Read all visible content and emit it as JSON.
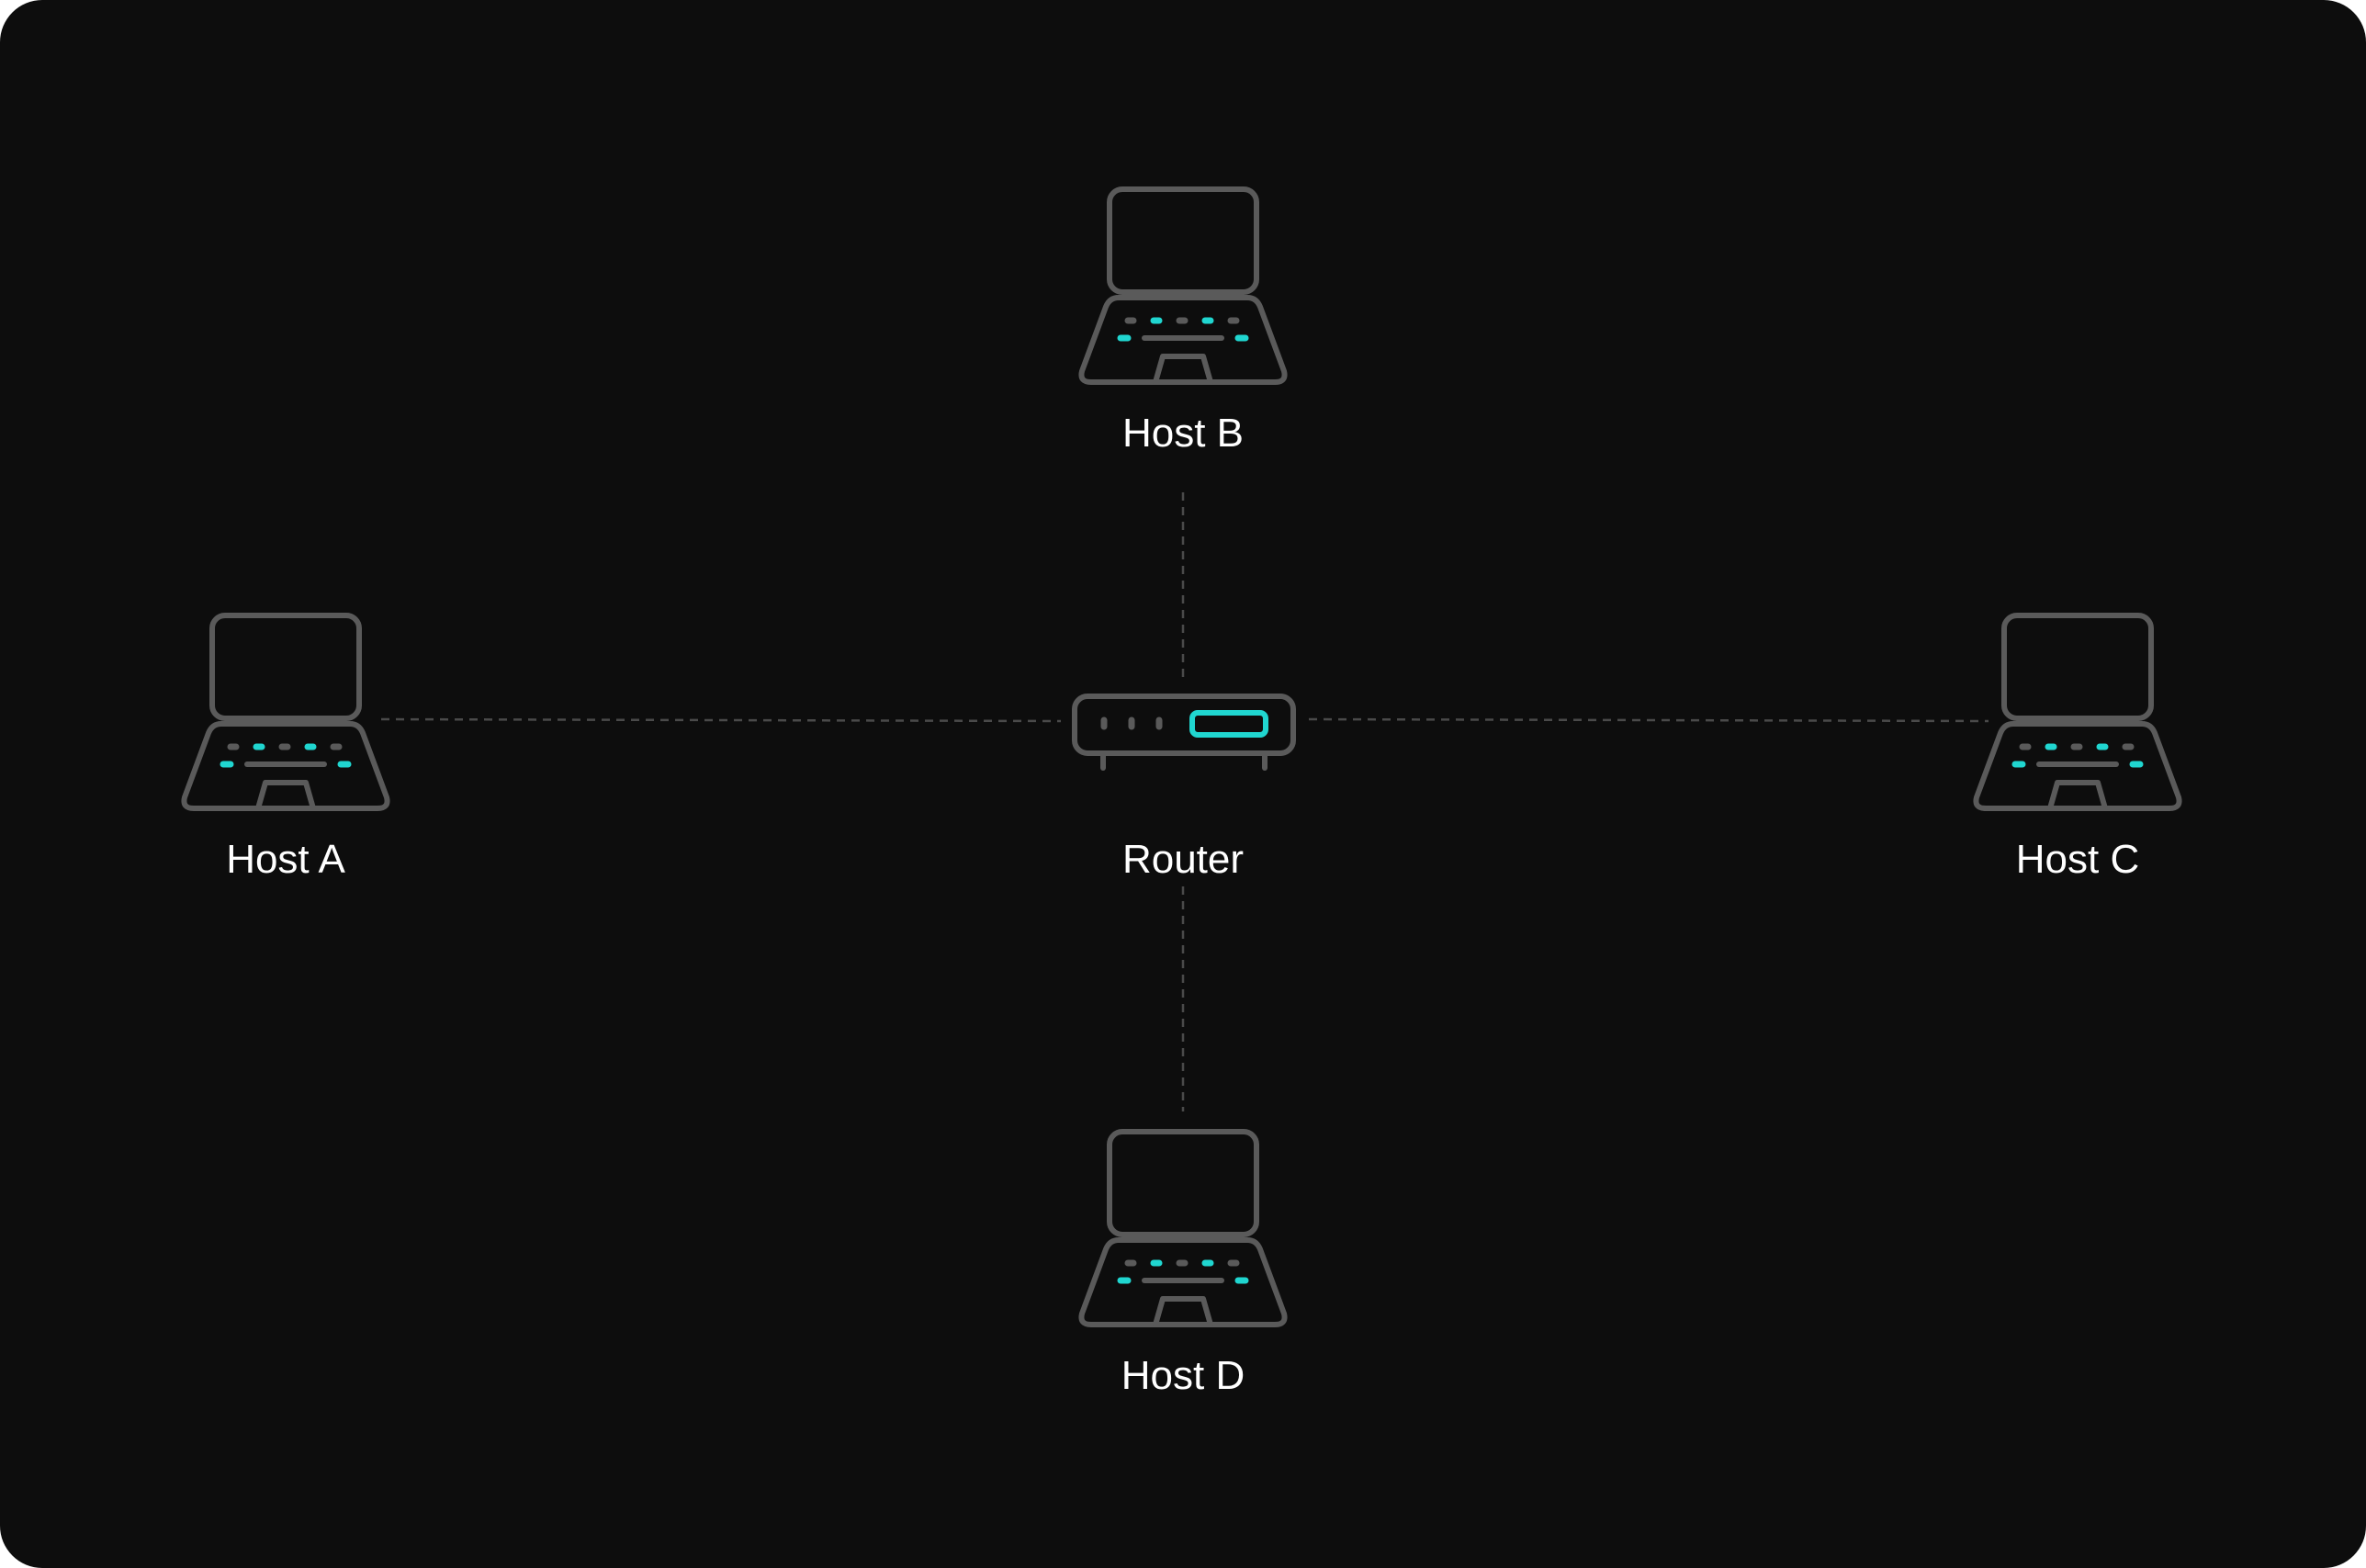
{
  "colors": {
    "background": "#0d0d0d",
    "device_outline": "#5a5a5a",
    "accent": "#20d6d0",
    "link": "#4a4a4a",
    "label": "#ffffff"
  },
  "icons": {
    "host": "laptop-icon",
    "router": "router-icon"
  },
  "nodes": {
    "router": {
      "label": "Router"
    },
    "host_a": {
      "label": "Host A"
    },
    "host_b": {
      "label": "Host B"
    },
    "host_c": {
      "label": "Host C"
    },
    "host_d": {
      "label": "Host D"
    }
  },
  "links": [
    {
      "from": "router",
      "to": "host_a"
    },
    {
      "from": "router",
      "to": "host_b"
    },
    {
      "from": "router",
      "to": "host_c"
    },
    {
      "from": "router",
      "to": "host_d"
    }
  ]
}
